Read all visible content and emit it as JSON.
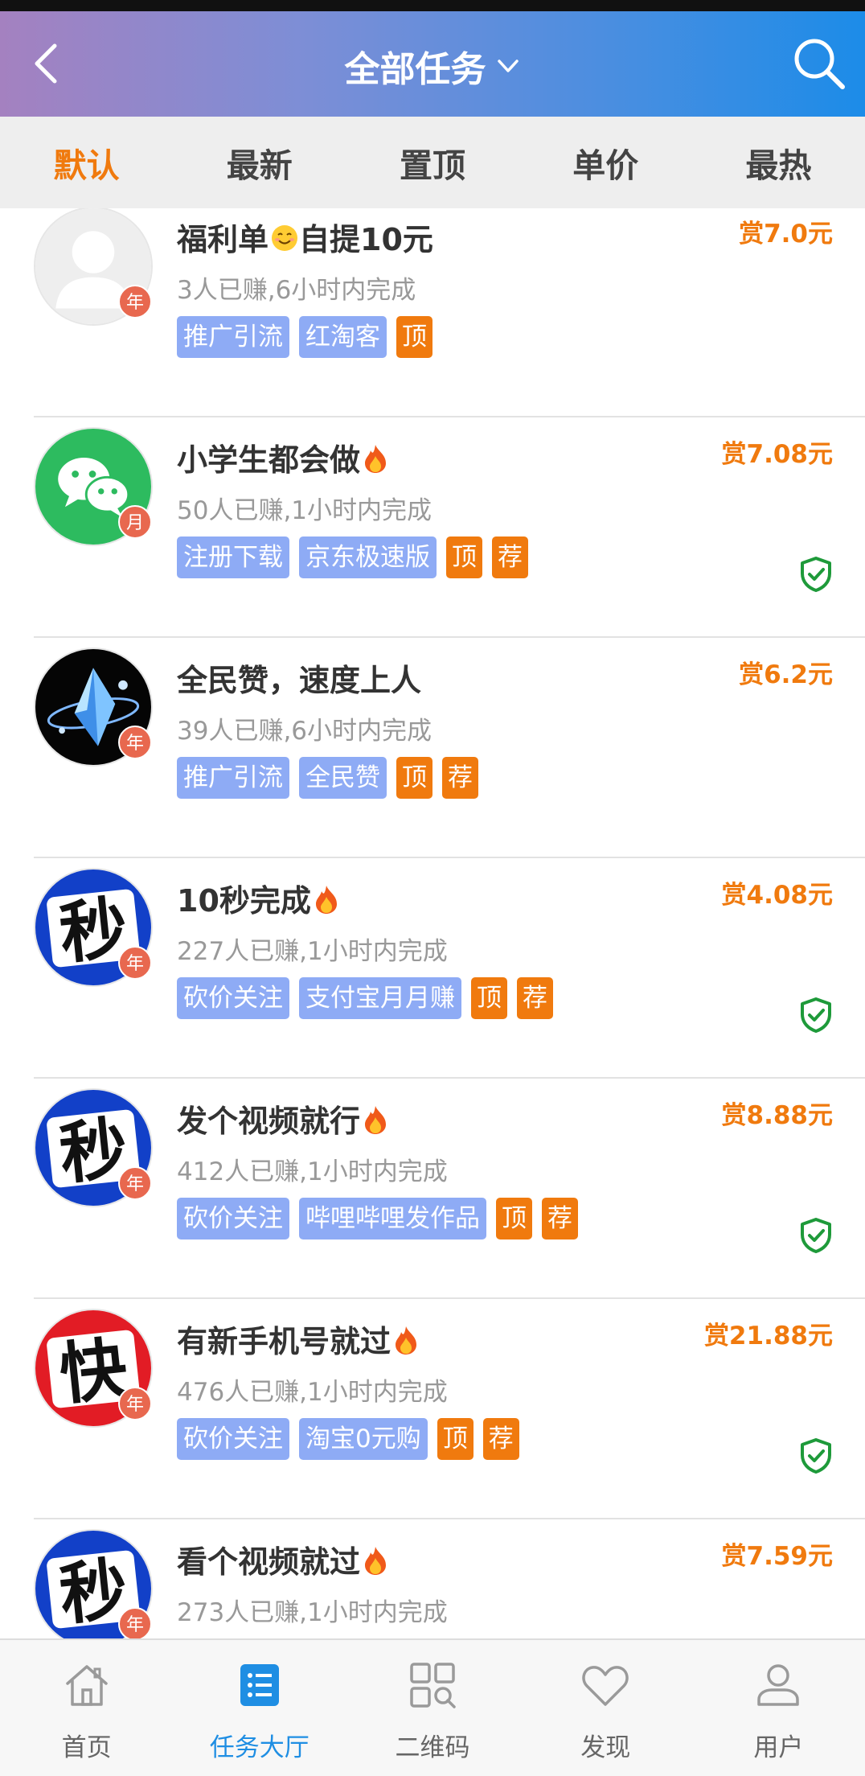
{
  "header": {
    "title": "全部任务",
    "back_icon": "chevron-left-icon",
    "search_icon": "search-icon",
    "gradient": [
      "#a481c0",
      "#1c8ce8"
    ]
  },
  "sort_tabs": [
    "默认",
    "最新",
    "置顶",
    "单价",
    "最热"
  ],
  "active_sort": "默认",
  "accent_color": "#f07a0e",
  "tasks": [
    {
      "avatar": "default-user",
      "period": "年",
      "title": "福利单",
      "emoji": "smiling-emoji",
      "title_suffix": "自提10元",
      "meta": "3人已赚,6小时内完成",
      "tags": [
        "推广引流",
        "红淘客"
      ],
      "hot_tags": [
        "顶"
      ],
      "reward": "赏7.0元",
      "verified": false
    },
    {
      "avatar": "wechat",
      "period": "月",
      "title": "小学生都会做",
      "emoji": "fire-emoji",
      "title_suffix": "",
      "meta": "50人已赚,1小时内完成",
      "tags": [
        "注册下载",
        "京东极速版"
      ],
      "hot_tags": [
        "顶",
        "荐"
      ],
      "reward": "赏7.08元",
      "verified": true
    },
    {
      "avatar": "crystal",
      "period": "年",
      "title": "全民赞，速度上人",
      "emoji": "",
      "title_suffix": "",
      "meta": "39人已赚,6小时内完成",
      "tags": [
        "推广引流",
        "全民赞"
      ],
      "hot_tags": [
        "顶",
        "荐"
      ],
      "reward": "赏6.2元",
      "verified": false
    },
    {
      "avatar": "miao",
      "period": "年",
      "title": "10秒完成",
      "emoji": "fire-emoji",
      "title_suffix": "",
      "meta": "227人已赚,1小时内完成",
      "tags": [
        "砍价关注",
        "支付宝月月赚"
      ],
      "hot_tags": [
        "顶",
        "荐"
      ],
      "reward": "赏4.08元",
      "verified": true
    },
    {
      "avatar": "miao",
      "period": "年",
      "title": "发个视频就行",
      "emoji": "fire-emoji",
      "title_suffix": "",
      "meta": "412人已赚,1小时内完成",
      "tags": [
        "砍价关注",
        "哔哩哔哩发作品"
      ],
      "hot_tags": [
        "顶",
        "荐"
      ],
      "reward": "赏8.88元",
      "verified": true
    },
    {
      "avatar": "kuai",
      "period": "年",
      "title": "有新手机号就过",
      "emoji": "fire-emoji",
      "title_suffix": "",
      "meta": "476人已赚,1小时内完成",
      "tags": [
        "砍价关注",
        "淘宝0元购"
      ],
      "hot_tags": [
        "顶",
        "荐"
      ],
      "reward": "赏21.88元",
      "verified": true
    },
    {
      "avatar": "miao",
      "period": "年",
      "title": "看个视频就过",
      "emoji": "fire-emoji",
      "title_suffix": "",
      "meta": "273人已赚,1小时内完成",
      "tags": [
        "",
        ""
      ],
      "hot_tags": [
        "",
        ""
      ],
      "reward": "赏7.59元",
      "verified": false
    }
  ],
  "avatar_glyphs": {
    "miao": "秒",
    "kuai": "快"
  },
  "tabbar": [
    {
      "label": "首页",
      "icon": "home-icon"
    },
    {
      "label": "任务大厅",
      "icon": "task-list-icon"
    },
    {
      "label": "二维码",
      "icon": "qrcode-scan-icon"
    },
    {
      "label": "发现",
      "icon": "heart-icon"
    },
    {
      "label": "用户",
      "icon": "user-icon"
    }
  ],
  "active_tab": "任务大厅"
}
